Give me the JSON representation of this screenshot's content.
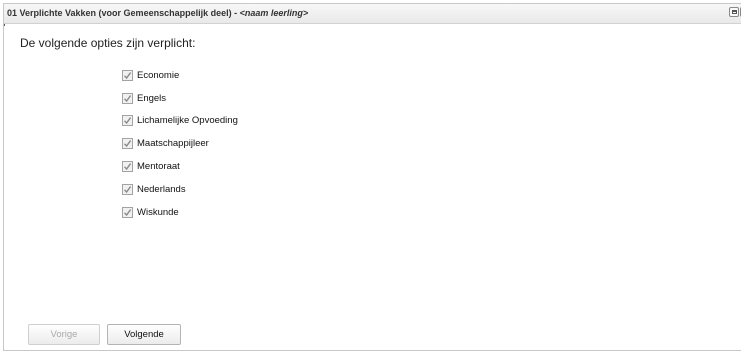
{
  "window": {
    "title_prefix": "01 Verplichte Vakken (voor Gemeenschappelijk deel) - ",
    "title_student": "<naam leerling>"
  },
  "intro_text": "De volgende opties zijn verplicht:",
  "options": [
    {
      "label": "Economie",
      "checked": true
    },
    {
      "label": "Engels",
      "checked": true
    },
    {
      "label": "Lichamelijke Opvoeding",
      "checked": true
    },
    {
      "label": "Maatschappijleer",
      "checked": true
    },
    {
      "label": "Mentoraat",
      "checked": true
    },
    {
      "label": "Nederlands",
      "checked": true
    },
    {
      "label": "Wiskunde",
      "checked": true
    }
  ],
  "buttons": {
    "prev_label": "Vorige",
    "next_label": "Volgende"
  },
  "icons": {
    "restore": "restore-window-icon",
    "close": "close-icon",
    "check": "checkmark-icon"
  },
  "colors": {
    "check": "#8a8a8a",
    "disabled_text": "#a9a9a9"
  }
}
